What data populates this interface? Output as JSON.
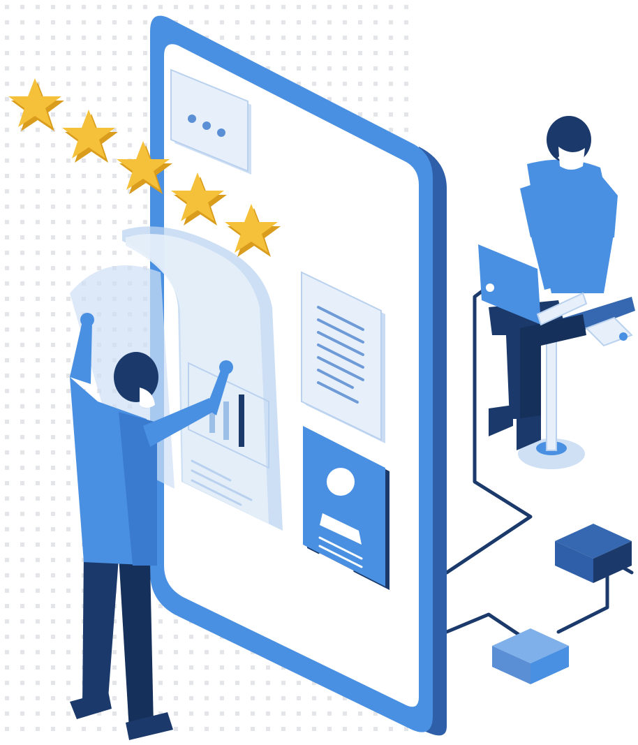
{
  "illustration": {
    "rating": {
      "stars_filled": 5,
      "stars_total": 5
    },
    "colors": {
      "primary": "#4a90e2",
      "primary_dark": "#3568b0",
      "navy": "#1b3a6b",
      "light_panel": "#dce9f8",
      "star": "#f5c13a",
      "star_shade": "#d99c1c",
      "dots": "#e3e5e8"
    },
    "icons": [
      "phone-icon",
      "chat-bubble-icon",
      "star-icon",
      "document-icon",
      "profile-card-icon",
      "bar-chart-icon",
      "laptop-icon",
      "stool-icon",
      "network-node-icon"
    ]
  }
}
